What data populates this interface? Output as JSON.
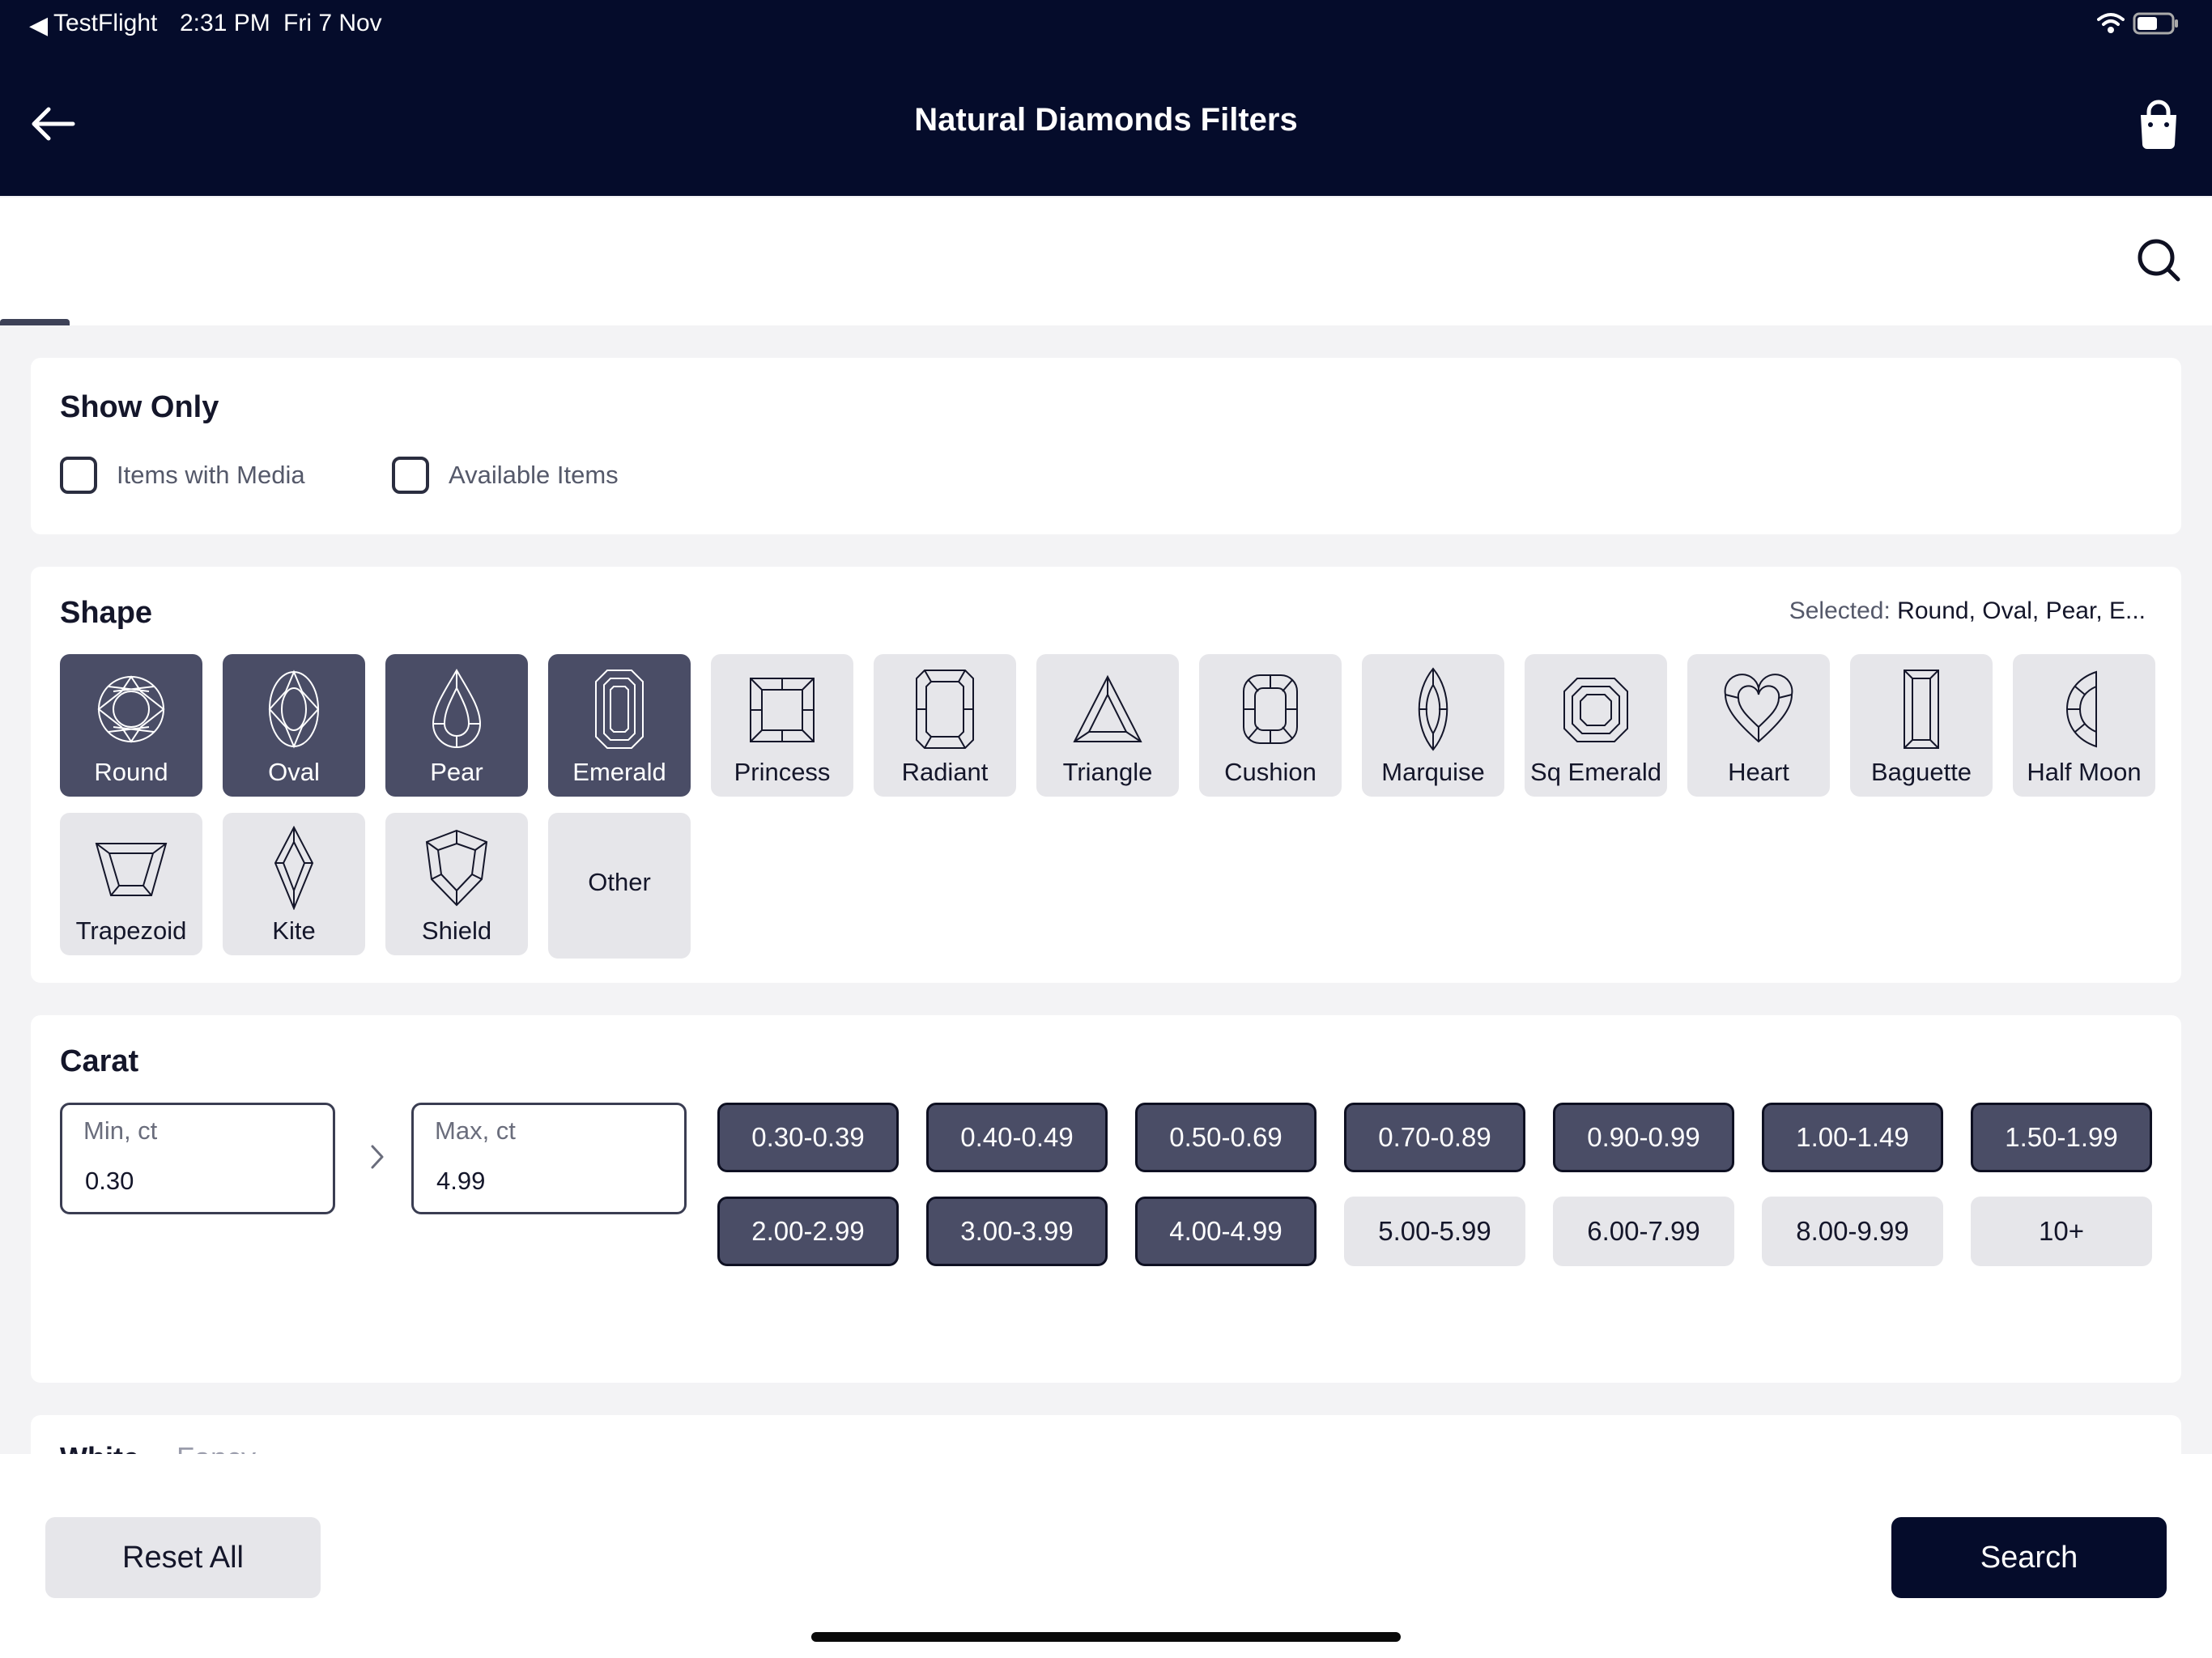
{
  "status_bar": {
    "back_arrow": "◀",
    "app": "TestFlight",
    "time": "2:31 PM",
    "date": "Fri 7 Nov",
    "wifi_icon": "wifi-icon",
    "battery_icon": "battery-icon"
  },
  "header": {
    "title": "Natural Diamonds Filters",
    "back_icon": "arrow-left-icon",
    "bag_icon": "shopping-bag-icon",
    "background": "#050c2b"
  },
  "search": {
    "icon": "search-icon"
  },
  "show_only": {
    "title": "Show Only",
    "options": [
      {
        "label": "Items with Media",
        "checked": false
      },
      {
        "label": "Available Items",
        "checked": false
      }
    ]
  },
  "shape": {
    "title": "Shape",
    "selected_label": "Selected:",
    "selected_value": "Round, Oval, Pear, E...",
    "items": [
      {
        "label": "Round",
        "selected": true,
        "icon": "round-diamond-icon"
      },
      {
        "label": "Oval",
        "selected": true,
        "icon": "oval-diamond-icon"
      },
      {
        "label": "Pear",
        "selected": true,
        "icon": "pear-diamond-icon"
      },
      {
        "label": "Emerald",
        "selected": true,
        "icon": "emerald-diamond-icon"
      },
      {
        "label": "Princess",
        "selected": false,
        "icon": "princess-diamond-icon"
      },
      {
        "label": "Radiant",
        "selected": false,
        "icon": "radiant-diamond-icon"
      },
      {
        "label": "Triangle",
        "selected": false,
        "icon": "triangle-diamond-icon"
      },
      {
        "label": "Cushion",
        "selected": false,
        "icon": "cushion-diamond-icon"
      },
      {
        "label": "Marquise",
        "selected": false,
        "icon": "marquise-diamond-icon"
      },
      {
        "label": "Sq Emerald",
        "selected": false,
        "icon": "square-emerald-diamond-icon"
      },
      {
        "label": "Heart",
        "selected": false,
        "icon": "heart-diamond-icon"
      },
      {
        "label": "Baguette",
        "selected": false,
        "icon": "baguette-diamond-icon"
      },
      {
        "label": "Half Moon",
        "selected": false,
        "icon": "half-moon-diamond-icon"
      },
      {
        "label": "Trapezoid",
        "selected": false,
        "icon": "trapezoid-diamond-icon"
      },
      {
        "label": "Kite",
        "selected": false,
        "icon": "kite-diamond-icon"
      },
      {
        "label": "Shield",
        "selected": false,
        "icon": "shield-diamond-icon"
      },
      {
        "label": "Other",
        "selected": false,
        "icon": ""
      }
    ]
  },
  "carat": {
    "title": "Carat",
    "min_placeholder": "Min, ct",
    "min_value": "0.30",
    "max_placeholder": "Max, ct",
    "max_value": "4.99",
    "separator_icon": "chevron-right-icon",
    "ranges": [
      {
        "label": "0.30-0.39",
        "selected": true
      },
      {
        "label": "0.40-0.49",
        "selected": true
      },
      {
        "label": "0.50-0.69",
        "selected": true
      },
      {
        "label": "0.70-0.89",
        "selected": true
      },
      {
        "label": "0.90-0.99",
        "selected": true
      },
      {
        "label": "1.00-1.49",
        "selected": true
      },
      {
        "label": "1.50-1.99",
        "selected": true
      },
      {
        "label": "2.00-2.99",
        "selected": true
      },
      {
        "label": "3.00-3.99",
        "selected": true
      },
      {
        "label": "4.00-4.99",
        "selected": true
      },
      {
        "label": "5.00-5.99",
        "selected": false
      },
      {
        "label": "6.00-7.99",
        "selected": false
      },
      {
        "label": "8.00-9.99",
        "selected": false
      },
      {
        "label": "10+",
        "selected": false
      }
    ]
  },
  "color": {
    "tabs": [
      "White",
      "Fancy"
    ]
  },
  "footer": {
    "reset_label": "Reset All",
    "search_label": "Search"
  }
}
